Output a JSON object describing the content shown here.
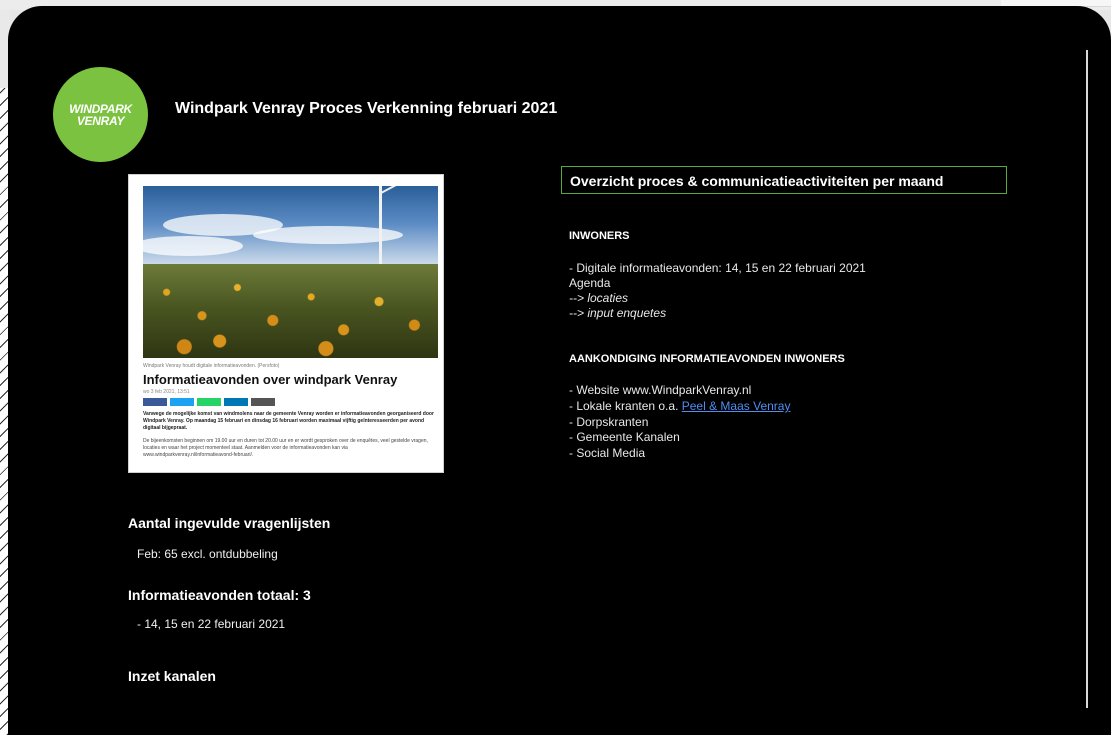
{
  "page": {
    "title": "Windpark Venray Proces Verkenning februari 2021",
    "logo_lines": [
      "WINDPARK",
      "VENRAY"
    ]
  },
  "article": {
    "caption": "Windpark Venray houdt digitale informatieavonden. (Persfoto)",
    "heading": "Informatieavonden over windpark Venray",
    "date": "wo 3 feb 2021, 13:51",
    "lead": "Vanwege de mogelijke komst van windmolens naar de gemeente Venray worden er informatieavonden georganiseerd door Windpark Venray. Op maandag 15 februari en dinsdag 16 februari worden maximaal vijftig geïnteresseerden per avond digitaal bijgepraat.",
    "body": "De bijeenkomsten beginnen om 19.00 uur en duren tot 20.00 uur en er wordt gesproken over de enquêtes, veel gestelde vragen, locaties en waar het project momenteel staat. Aanmelden voor de informatieavonden kan via www.windparkvenray.nl/informatieavond-februari/.",
    "share_colors": [
      "#3b5998",
      "#1da1f2",
      "#25d366",
      "#0077b5",
      "#555555"
    ]
  },
  "left": {
    "vragenlijsten_heading": "Aantal ingevulde vragenlijsten",
    "vragenlijsten_value": "Feb: 65 excl. ontdubbeling",
    "avonden_heading": "Informatieavonden totaal: 3",
    "avonden_value": "- 14, 15 en 22 februari 2021",
    "kanalen_heading": "Inzet kanalen"
  },
  "right": {
    "overview_title": "Overzicht proces & communicatieactiviteiten per maand",
    "inwoners": {
      "heading": "INWONERS",
      "lines": [
        "- Digitale informatieavonden: 14, 15 en 22 februari 2021",
        "Agenda"
      ],
      "italic_lines": [
        "--> locaties",
        "--> input enquetes"
      ]
    },
    "aankondiging": {
      "heading": "AANKONDIGING INFORMATIEAVONDEN INWONERS",
      "line1": "- Website www.WindparkVenray.nl",
      "line2_prefix": "- Lokale kranten o.a. ",
      "line2_link": "Peel & Maas Venray",
      "line3": "- Dorpskranten",
      "line4": "- Gemeente Kanalen",
      "line5": "- Social Media"
    }
  },
  "colors": {
    "background": "#000000",
    "logo_green": "#7cc241",
    "box_border": "#5aa83c",
    "link": "#4d8ef0"
  }
}
